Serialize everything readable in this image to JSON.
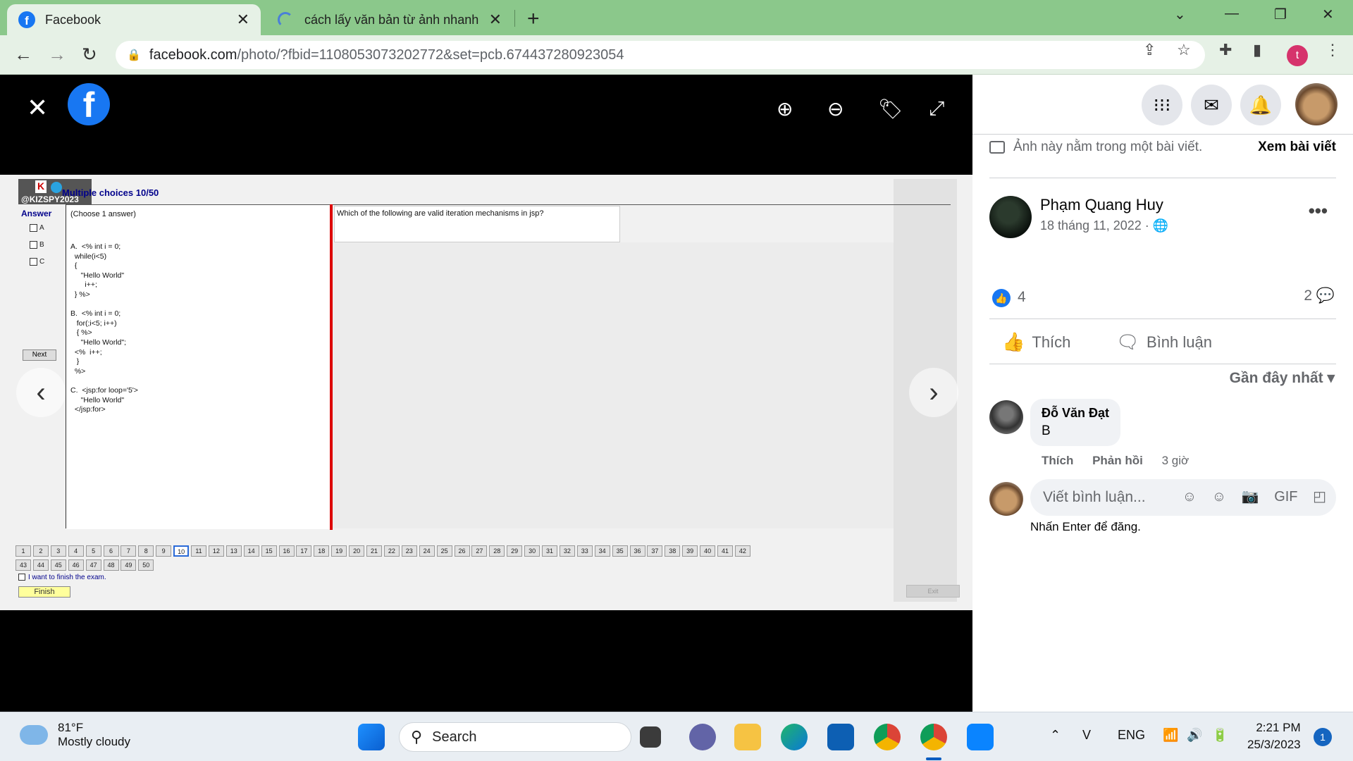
{
  "browser": {
    "tabs": [
      {
        "title": "Facebook",
        "favicon": "facebook-icon",
        "active": true
      },
      {
        "title": "cách lấy văn bản từ ảnh nhanh tr",
        "favicon": "loading-spinner-icon",
        "active": false
      }
    ],
    "url_host": "facebook.com",
    "url_path": "/photo/?fbid=1108053073202772&set=pcb.674437280923054",
    "profile_initial": "t"
  },
  "exam": {
    "badge_text": "@KIZSPY2023",
    "title": "Multiple choices 10/50",
    "answer_label": "Answer",
    "checkboxes": [
      "A",
      "B",
      "C"
    ],
    "next_label": "Next",
    "instruction": "(Choose 1 answer)",
    "options_text": "A.  <% int i = 0;\n  while(i<5)\n  {\n     \"Hello World\"\n       i++;\n  } %>\n\nB.  <% int i = 0;\n   for(;i<5; i++)\n   { %>\n     \"Hello World\";\n  <%  i++;\n   }\n  %>\n\nC.  <jsp:for loop='5'>\n     \"Hello World\"\n  </jsp:for>",
    "question": "Which of the following are valid iteration mechanisms in jsp?",
    "pages_row1": [
      "1",
      "2",
      "3",
      "4",
      "5",
      "6",
      "7",
      "8",
      "9",
      "10",
      "11",
      "12",
      "13",
      "14",
      "15",
      "16",
      "17",
      "18",
      "19",
      "20",
      "21",
      "22",
      "23",
      "24",
      "25",
      "26",
      "27",
      "28",
      "29",
      "30",
      "31",
      "32",
      "33",
      "34",
      "35",
      "36",
      "37",
      "38",
      "39",
      "40",
      "41",
      "42"
    ],
    "pages_row2": [
      "43",
      "44",
      "45",
      "46",
      "47",
      "48",
      "49",
      "50"
    ],
    "current_page": "10",
    "finish_check_label": "I want to finish the exam.",
    "finish_label": "Finish",
    "exit_label": "Exit"
  },
  "panel": {
    "post_note": "Ảnh này nằm trong một bài viết.",
    "see_post": "Xem bài viết",
    "author": "Phạm Quang Huy",
    "date": "18 tháng 11, 2022 ·",
    "reaction_count": "4",
    "comment_count": "2",
    "like_label": "Thích",
    "comment_label": "Bình luận",
    "sort_label": "Gần đây nhất",
    "comments": [
      {
        "name": "Đỗ Văn Đạt",
        "text": "B",
        "like": "Thích",
        "reply": "Phản hồi",
        "time": "3 giờ"
      }
    ],
    "input_placeholder": "Viết bình luận...",
    "hint": "Nhấn Enter để đăng."
  },
  "taskbar": {
    "temperature": "81°F",
    "weather": "Mostly cloudy",
    "search_label": "Search",
    "language": "ENG",
    "time": "2:21 PM",
    "date": "25/3/2023",
    "notification_count": "1"
  },
  "colors": {
    "facebook_blue": "#1877f2",
    "tab_strip": "#8bc88b",
    "exam_red_bar": "#dd0000"
  }
}
